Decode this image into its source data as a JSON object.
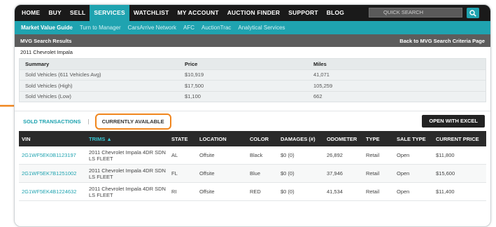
{
  "nav": {
    "items": [
      "HOME",
      "BUY",
      "SELL",
      "SERVICES",
      "WATCHLIST",
      "MY ACCOUNT",
      "AUCTION FINDER",
      "SUPPORT",
      "BLOG"
    ],
    "active_index": 3,
    "search_placeholder": "QUICK SEARCH"
  },
  "subnav": {
    "items": [
      "Market Value Guide",
      "Turn to Manager",
      "CarsArrive Network",
      "AFC",
      "AuctionTrac",
      "Analytical Services"
    ],
    "active_index": 0
  },
  "results_bar": {
    "title": "MVG Search Results",
    "back_link": "Back to MVG Search Criteria Page"
  },
  "vehicle_title": "2011 Chevrolet Impala",
  "summary": {
    "headers": [
      "Summary",
      "Price",
      "Miles"
    ],
    "rows": [
      [
        "Sold Vehicles (611 Vehicles Avg)",
        "$10,919",
        "41,071"
      ],
      [
        "Sold Vehicles (High)",
        "$17,500",
        "105,259"
      ],
      [
        "Sold Vehicles (Low)",
        "$1,100",
        "662"
      ]
    ]
  },
  "tabs": {
    "sold": "SOLD TRANSACTIONS",
    "separator": "|",
    "current": "CURRENTLY AVAILABLE",
    "excel": "OPEN WITH EXCEL"
  },
  "table": {
    "headers": [
      "VIN",
      "TRIMS ▲",
      "STATE",
      "LOCATION",
      "COLOR",
      "DAMAGES (#)",
      "ODOMETER",
      "TYPE",
      "SALE TYPE",
      "CURRENT PRICE"
    ],
    "rows": [
      [
        "2G1WF5EK0B1123197",
        "2011 Chevrolet Impala 4DR SDN LS FLEET",
        "AL",
        "Offsite",
        "Black",
        "$0 (0)",
        "26,892",
        "Retail",
        "Open",
        "$11,800"
      ],
      [
        "2G1WF5EK7B1251002",
        "2011 Chevrolet Impala 4DR SDN LS FLEET",
        "FL",
        "Offsite",
        "Blue",
        "$0 (0)",
        "37,946",
        "Retail",
        "Open",
        "$15,600"
      ],
      [
        "2G1WF5EK4B1224632",
        "2011 Chevrolet Impala 4DR SDN LS FLEET",
        "RI",
        "Offsite",
        "RED",
        "$0 (0)",
        "41,534",
        "Retail",
        "Open",
        "$11,400"
      ]
    ]
  },
  "colors": {
    "accent": "#1fa3b0",
    "nav_bg": "#1a1a1a",
    "highlight": "#f0861e"
  }
}
